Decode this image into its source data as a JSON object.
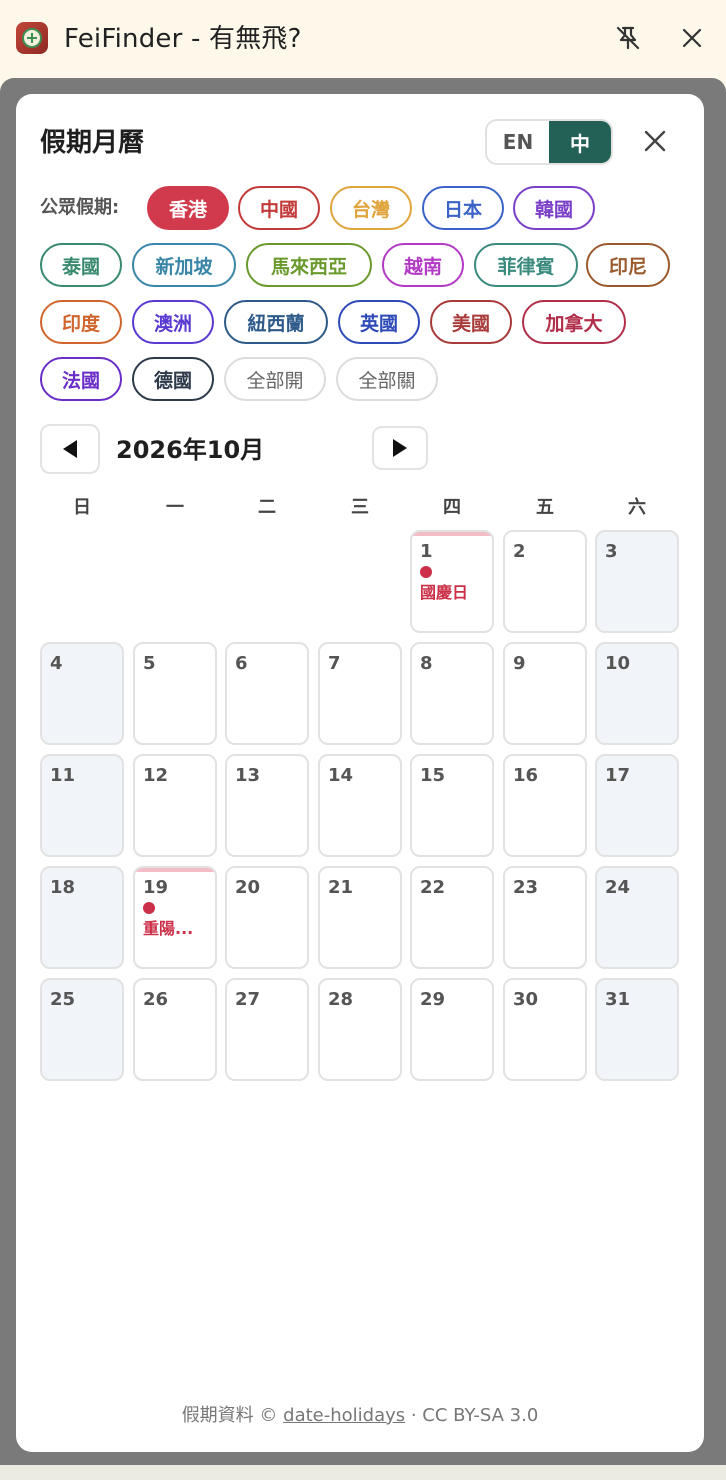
{
  "window": {
    "title": "FeiFinder - 有無飛?"
  },
  "panel": {
    "title": "假期月曆",
    "lang": {
      "en": "EN",
      "zh": "中",
      "active": "zh"
    }
  },
  "holidays": {
    "label": "公眾假期:",
    "chips": [
      {
        "id": "hk",
        "label": "香港",
        "color": "#d03a4c",
        "active": true
      },
      {
        "id": "cn",
        "label": "中國",
        "color": "#c23a3a",
        "active": false
      },
      {
        "id": "tw",
        "label": "台灣",
        "color": "#e0a43c",
        "active": false
      },
      {
        "id": "jp",
        "label": "日本",
        "color": "#3a62c7",
        "active": false
      },
      {
        "id": "kr",
        "label": "韓國",
        "color": "#7b3fc7",
        "active": false
      },
      {
        "id": "th",
        "label": "泰國",
        "color": "#3a8a6e",
        "active": false
      },
      {
        "id": "sg",
        "label": "新加坡",
        "color": "#3a86a8",
        "active": false
      },
      {
        "id": "my",
        "label": "馬來西亞",
        "color": "#6a9a2e",
        "active": false
      },
      {
        "id": "vn",
        "label": "越南",
        "color": "#b23ac4",
        "active": false
      },
      {
        "id": "ph",
        "label": "菲律賓",
        "color": "#3a8a7e",
        "active": false
      },
      {
        "id": "id",
        "label": "印尼",
        "color": "#9a5a2e",
        "active": false
      },
      {
        "id": "in",
        "label": "印度",
        "color": "#d0662e",
        "active": false
      },
      {
        "id": "au",
        "label": "澳洲",
        "color": "#5a3ad0",
        "active": false
      },
      {
        "id": "nz",
        "label": "紐西蘭",
        "color": "#2e5a8a",
        "active": false
      },
      {
        "id": "uk",
        "label": "英國",
        "color": "#2e4ab8",
        "active": false
      },
      {
        "id": "us",
        "label": "美國",
        "color": "#a83a3a",
        "active": false
      },
      {
        "id": "ca",
        "label": "加拿大",
        "color": "#b02e4a",
        "active": false
      },
      {
        "id": "fr",
        "label": "法國",
        "color": "#6a2ec7",
        "active": false
      },
      {
        "id": "de",
        "label": "德國",
        "color": "#2e3a4a",
        "active": false
      }
    ],
    "all_on": "全部開",
    "all_off": "全部關"
  },
  "calendar": {
    "month_label": "2026年10月",
    "weekdays": [
      "日",
      "一",
      "二",
      "三",
      "四",
      "五",
      "六"
    ],
    "first_weekday": 4,
    "days_in_month": 31,
    "holidays": [
      {
        "day": 1,
        "name": "國慶日"
      },
      {
        "day": 19,
        "name": "重陽..."
      }
    ]
  },
  "footer": {
    "prefix": "假期資料 © ",
    "link": "date-holidays",
    "suffix": " · CC BY-SA 3.0"
  },
  "colors": {
    "accent": "#236055",
    "holiday_red": "#cc2f48"
  }
}
